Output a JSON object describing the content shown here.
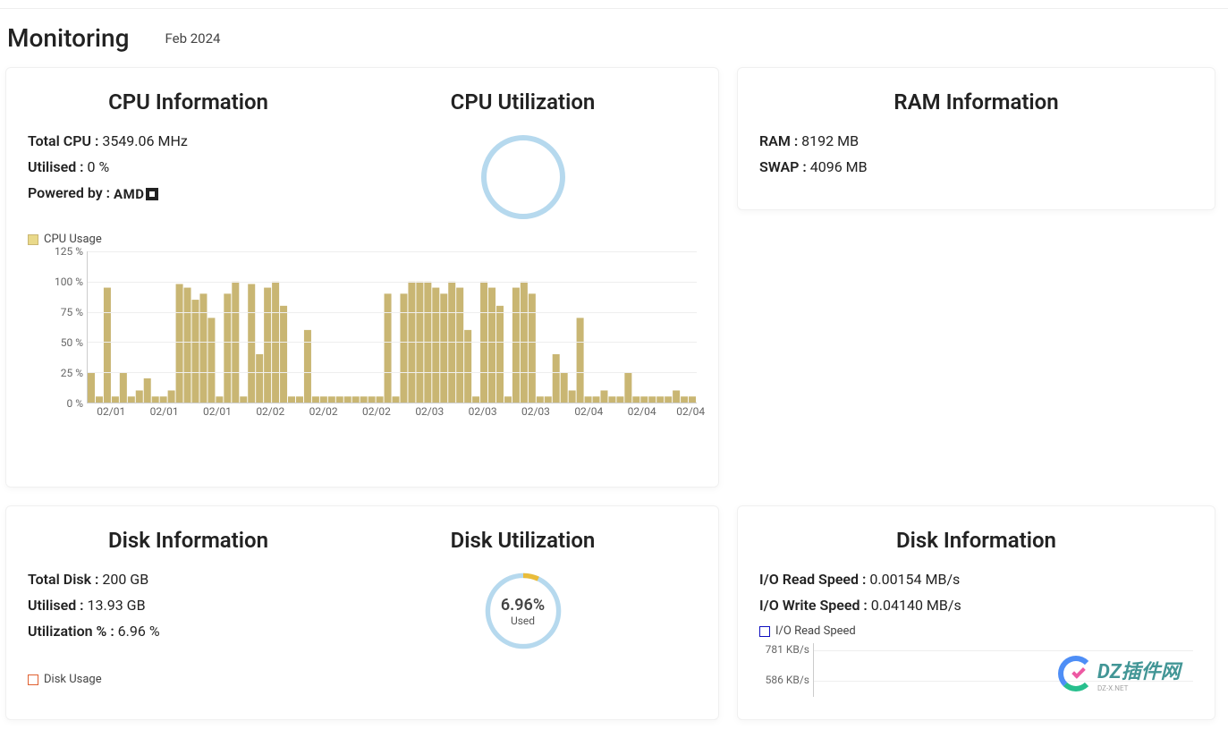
{
  "header": {
    "title": "Monitoring",
    "date": "Feb 2024"
  },
  "cpu_info": {
    "title": "CPU Information",
    "total_label": "Total CPU : ",
    "total_value": "3549.06 MHz",
    "utilised_label": "Utilised : ",
    "utilised_value": "0 %",
    "powered_label": "Powered by : ",
    "powered_value": "AMD"
  },
  "cpu_util": {
    "title": "CPU Utilization",
    "percent": 0
  },
  "ram_info": {
    "title": "RAM Information",
    "ram_label": "RAM : ",
    "ram_value": "8192 MB",
    "swap_label": "SWAP : ",
    "swap_value": "4096 MB"
  },
  "disk_info": {
    "title": "Disk Information",
    "total_label": "Total Disk : ",
    "total_value": "200 GB",
    "utilised_label": "Utilised : ",
    "utilised_value": "13.93 GB",
    "pct_label": "Utilization % : ",
    "pct_value": "6.96 %"
  },
  "disk_util": {
    "title": "Disk Utilization",
    "percent_display": "6.96%",
    "percent": 6.96,
    "sub": "Used"
  },
  "disk_io": {
    "title": "Disk Information",
    "read_label": "I/O Read Speed : ",
    "read_value": "0.00154 MB/s",
    "write_label": "I/O Write Speed : ",
    "write_value": "0.04140 MB/s",
    "legend": "I/O Read Speed",
    "legend_color": "#1010c0",
    "y_ticks": [
      "781 KB/s",
      "586 KB/s"
    ]
  },
  "cpu_chart": {
    "legend": "CPU Usage",
    "legend_color": "#c9b673",
    "y_ticks": [
      "125 %",
      "100 %",
      "75 %",
      "50 %",
      "25 %",
      "0 %"
    ],
    "x_ticks": [
      "02/01",
      "02/01",
      "02/01",
      "02/02",
      "02/02",
      "02/02",
      "02/03",
      "02/03",
      "02/03",
      "02/04",
      "02/04",
      "02/04"
    ]
  },
  "disk_chart": {
    "legend": "Disk Usage",
    "legend_color": "#e06030"
  },
  "chart_data": [
    {
      "type": "bar",
      "title": "CPU Usage",
      "ylabel": "%",
      "ylim": [
        0,
        125
      ],
      "x_categories": [
        "02/01",
        "02/01",
        "02/01",
        "02/02",
        "02/02",
        "02/02",
        "02/03",
        "02/03",
        "02/03",
        "02/04",
        "02/04",
        "02/04"
      ],
      "series": [
        {
          "name": "CPU Usage",
          "color": "#c9b673",
          "values": [
            25,
            5,
            95,
            5,
            25,
            5,
            10,
            20,
            5,
            5,
            10,
            98,
            95,
            85,
            90,
            70,
            5,
            90,
            100,
            5,
            98,
            40,
            95,
            100,
            80,
            5,
            5,
            60,
            5,
            5,
            5,
            5,
            5,
            5,
            5,
            5,
            5,
            90,
            5,
            90,
            100,
            100,
            100,
            95,
            90,
            100,
            95,
            60,
            5,
            100,
            95,
            80,
            5,
            95,
            100,
            90,
            5,
            5,
            40,
            25,
            10,
            70,
            5,
            5,
            10,
            5,
            5,
            25,
            5,
            5,
            5,
            5,
            5,
            10,
            5,
            5
          ]
        }
      ]
    },
    {
      "type": "line",
      "title": "I/O Read Speed",
      "ylabel": "KB/s",
      "ylim": [
        0,
        781
      ],
      "series": [
        {
          "name": "I/O Read Speed",
          "color": "#1010c0",
          "values": []
        }
      ]
    }
  ],
  "watermark": {
    "brand": "DZ插件网",
    "sub": "DZ-X.NET"
  }
}
